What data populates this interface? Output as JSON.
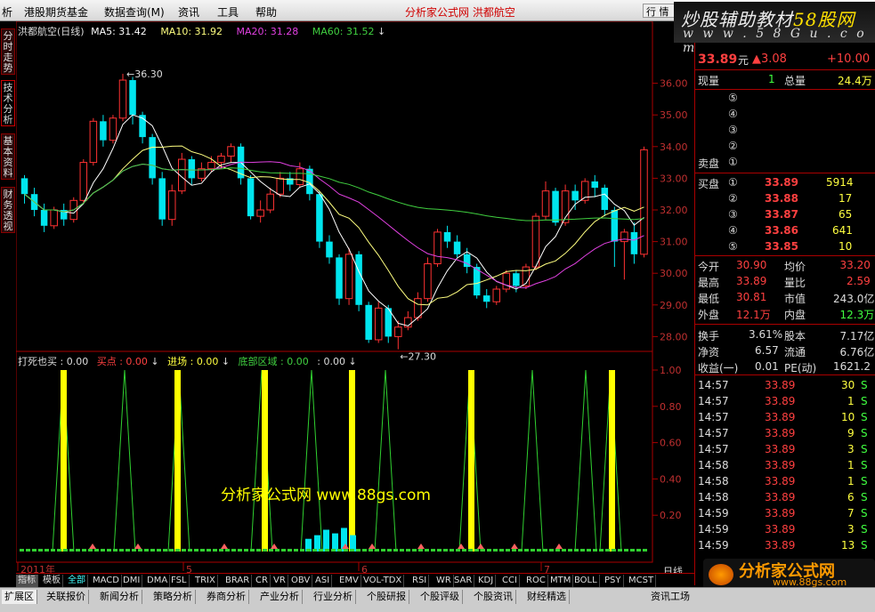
{
  "menu": {
    "items": [
      "析",
      "港股期货基金",
      "数据查询(M)",
      "资讯",
      "工具",
      "帮助"
    ],
    "title": "分析家公式网 洪都航空",
    "right_btn": "行 情"
  },
  "watermark_top": {
    "line1a": "炒股辅助教材",
    "line1b": "58股网",
    "line2": "w w w . 5 8 G u . c o m"
  },
  "left_tabs": [
    "分时走势",
    "技术分析",
    "基本资料",
    "财务透视"
  ],
  "main_header": {
    "stock": "洪都航空(日线)",
    "ma5": "MA5: 31.42",
    "ma10": "MA10: 31.92",
    "ma20": "MA20: 31.28",
    "ma60": "MA60: 31.52"
  },
  "annotations": {
    "high": "36.30",
    "low": "27.30"
  },
  "price_axis": [
    "36.00",
    "35.00",
    "34.00",
    "33.00",
    "32.00",
    "31.00",
    "30.00",
    "29.00",
    "28.00"
  ],
  "ind_header": {
    "name": "打死也买 : 0.00",
    "buy": "买点 : 0.00",
    "enter": "进场 : 0.00",
    "bottom": "底部区域 : 0.00",
    "extra": ": 0.00"
  },
  "ind_axis": [
    "1.00",
    "0.80",
    "0.60",
    "0.40",
    "0.20"
  ],
  "center_watermark": "分析家公式网  www.88gs.com",
  "date_labels": [
    "2011年",
    "5",
    "6",
    "7"
  ],
  "period": "日线",
  "chart_data": {
    "type": "candlestick",
    "ylim": [
      27,
      37
    ],
    "candles": [
      [
        33.0,
        32.5,
        33.1,
        32.2
      ],
      [
        32.5,
        32.0,
        32.7,
        31.8
      ],
      [
        32.0,
        31.5,
        32.2,
        31.3
      ],
      [
        31.5,
        32.0,
        32.1,
        31.4
      ],
      [
        32.0,
        31.7,
        32.2,
        31.5
      ],
      [
        31.7,
        32.3,
        32.4,
        31.6
      ],
      [
        32.3,
        33.5,
        33.6,
        32.2
      ],
      [
        33.5,
        34.8,
        34.9,
        33.4
      ],
      [
        34.8,
        34.2,
        35.0,
        34.0
      ],
      [
        34.2,
        34.9,
        35.0,
        34.1
      ],
      [
        34.9,
        36.1,
        36.3,
        34.8
      ],
      [
        36.1,
        35.0,
        36.2,
        34.7
      ],
      [
        35.0,
        34.3,
        35.1,
        34.1
      ],
      [
        34.3,
        33.0,
        34.4,
        32.8
      ],
      [
        33.0,
        31.7,
        33.2,
        31.5
      ],
      [
        31.7,
        32.6,
        32.8,
        31.5
      ],
      [
        32.6,
        33.6,
        33.8,
        32.5
      ],
      [
        33.6,
        33.0,
        33.7,
        32.8
      ],
      [
        33.0,
        33.3,
        33.5,
        32.9
      ],
      [
        33.3,
        33.5,
        33.7,
        33.2
      ],
      [
        33.5,
        33.7,
        33.8,
        33.3
      ],
      [
        33.7,
        34.0,
        34.1,
        33.5
      ],
      [
        34.0,
        33.0,
        34.1,
        32.8
      ],
      [
        33.0,
        31.8,
        33.1,
        31.7
      ],
      [
        31.8,
        32.0,
        32.3,
        31.6
      ],
      [
        32.0,
        32.5,
        32.7,
        31.9
      ],
      [
        32.5,
        33.0,
        33.2,
        32.4
      ],
      [
        33.0,
        32.8,
        33.2,
        32.6
      ],
      [
        32.8,
        33.3,
        33.5,
        32.7
      ],
      [
        33.3,
        32.5,
        33.4,
        32.3
      ],
      [
        32.5,
        31.0,
        32.6,
        30.8
      ],
      [
        31.0,
        30.5,
        31.2,
        30.3
      ],
      [
        30.5,
        29.2,
        30.6,
        29.0
      ],
      [
        29.2,
        30.6,
        30.8,
        29.0
      ],
      [
        30.6,
        29.0,
        30.7,
        28.8
      ],
      [
        29.0,
        27.9,
        29.1,
        27.8
      ],
      [
        27.9,
        28.9,
        29.1,
        27.8
      ],
      [
        28.9,
        28.0,
        29.0,
        27.8
      ],
      [
        28.0,
        28.3,
        28.5,
        27.6
      ],
      [
        28.3,
        28.6,
        28.8,
        28.2
      ],
      [
        28.6,
        29.2,
        29.4,
        28.5
      ],
      [
        29.2,
        30.3,
        30.5,
        29.1
      ],
      [
        30.3,
        31.3,
        31.4,
        30.2
      ],
      [
        31.3,
        31.0,
        31.5,
        30.8
      ],
      [
        31.0,
        30.6,
        31.2,
        30.5
      ],
      [
        30.6,
        30.2,
        30.8,
        30.0
      ],
      [
        30.2,
        29.3,
        30.3,
        29.2
      ],
      [
        29.3,
        29.1,
        29.5,
        28.9
      ],
      [
        29.1,
        29.5,
        29.6,
        29.0
      ],
      [
        29.5,
        30.0,
        30.1,
        29.4
      ],
      [
        30.0,
        29.6,
        30.1,
        29.4
      ],
      [
        29.6,
        30.2,
        30.3,
        29.5
      ],
      [
        30.2,
        31.8,
        31.9,
        30.1
      ],
      [
        31.8,
        32.6,
        32.9,
        31.7
      ],
      [
        32.6,
        31.6,
        32.7,
        31.5
      ],
      [
        31.6,
        32.6,
        32.8,
        31.5
      ],
      [
        32.6,
        32.3,
        32.8,
        32.0
      ],
      [
        32.3,
        32.9,
        33.0,
        32.2
      ],
      [
        32.9,
        32.7,
        33.1,
        32.4
      ],
      [
        32.7,
        32.0,
        32.8,
        31.8
      ],
      [
        32.0,
        31.0,
        32.1,
        30.2
      ],
      [
        31.0,
        31.3,
        31.4,
        29.8
      ],
      [
        31.3,
        30.6,
        31.6,
        30.3
      ],
      [
        30.6,
        33.9,
        34.0,
        30.5
      ]
    ]
  },
  "quote": {
    "price": "33.89",
    "price_unit": "元",
    "chg": "▲3.08",
    "pct": "+10.00",
    "xianpan_l": "现量",
    "xianpan_v": "1",
    "zongliang_l": "总量",
    "zongliang_v": "24.4万",
    "sell_label": "卖盘",
    "sell_levels": [
      "⑤",
      "④",
      "③",
      "②",
      "①"
    ],
    "buy_label": "买盘",
    "buy_levels": [
      {
        "n": "①",
        "p": "33.89",
        "v": "5914"
      },
      {
        "n": "②",
        "p": "33.88",
        "v": "17"
      },
      {
        "n": "③",
        "p": "33.87",
        "v": "65"
      },
      {
        "n": "④",
        "p": "33.86",
        "v": "641"
      },
      {
        "n": "⑤",
        "p": "33.85",
        "v": "10"
      }
    ],
    "stats": [
      {
        "l1": "今开",
        "v1": "30.90",
        "l2": "均价",
        "v2": "33.20"
      },
      {
        "l1": "最高",
        "v1": "33.89",
        "l2": "量比",
        "v2": "2.59"
      },
      {
        "l1": "最低",
        "v1": "30.81",
        "l2": "市值",
        "v2": "243.0亿"
      },
      {
        "l1": "外盘",
        "v1": "12.1万",
        "l2": "内盘",
        "v2": "12.3万"
      }
    ],
    "fin": [
      {
        "l1": "换手",
        "v1": "3.61%",
        "l2": "股本",
        "v2": "7.17亿"
      },
      {
        "l1": "净资",
        "v1": "6.57",
        "l2": "流通",
        "v2": "6.76亿"
      },
      {
        "l1": "收益(一)",
        "v1": "0.01",
        "l2": "PE(动)",
        "v2": "1621.2"
      }
    ],
    "ticks": [
      {
        "t": "14:57",
        "p": "33.89",
        "v": "30",
        "s": "S"
      },
      {
        "t": "14:57",
        "p": "33.89",
        "v": "1",
        "s": "S"
      },
      {
        "t": "14:57",
        "p": "33.89",
        "v": "10",
        "s": "S"
      },
      {
        "t": "14:57",
        "p": "33.89",
        "v": "9",
        "s": "S"
      },
      {
        "t": "14:57",
        "p": "33.89",
        "v": "3",
        "s": "S"
      },
      {
        "t": "14:58",
        "p": "33.89",
        "v": "1",
        "s": "S"
      },
      {
        "t": "14:58",
        "p": "33.89",
        "v": "1",
        "s": "S"
      },
      {
        "t": "14:58",
        "p": "33.89",
        "v": "6",
        "s": "S"
      },
      {
        "t": "14:59",
        "p": "33.89",
        "v": "7",
        "s": "S"
      },
      {
        "t": "14:59",
        "p": "33.89",
        "v": "3",
        "s": "S"
      },
      {
        "t": "14:59",
        "p": "33.89",
        "v": "13",
        "s": "S"
      }
    ]
  },
  "tabs": [
    "指标",
    "模板",
    "全部",
    "MACD",
    "DMI",
    "DMA",
    "FSL",
    "TRIX",
    "BRAR",
    "CR",
    "VR",
    "OBV",
    "ASI",
    "EMV",
    "VOL-TDX",
    "RSI",
    "WR",
    "SAR",
    "KDJ",
    "CCI",
    "ROC",
    "MTM",
    "BOLL",
    "PSY",
    "MCST"
  ],
  "bottom": [
    "扩展区",
    "关联报价",
    "新闻分析",
    "策略分析",
    "券商分析",
    "产业分析",
    "行业分析",
    "个股研报",
    "个股评级",
    "个股资讯",
    "财经精选"
  ],
  "bottom_right": "资讯工场",
  "watermark_bottom": {
    "a": "分析家公式网",
    "b": "www.88gs.com"
  }
}
